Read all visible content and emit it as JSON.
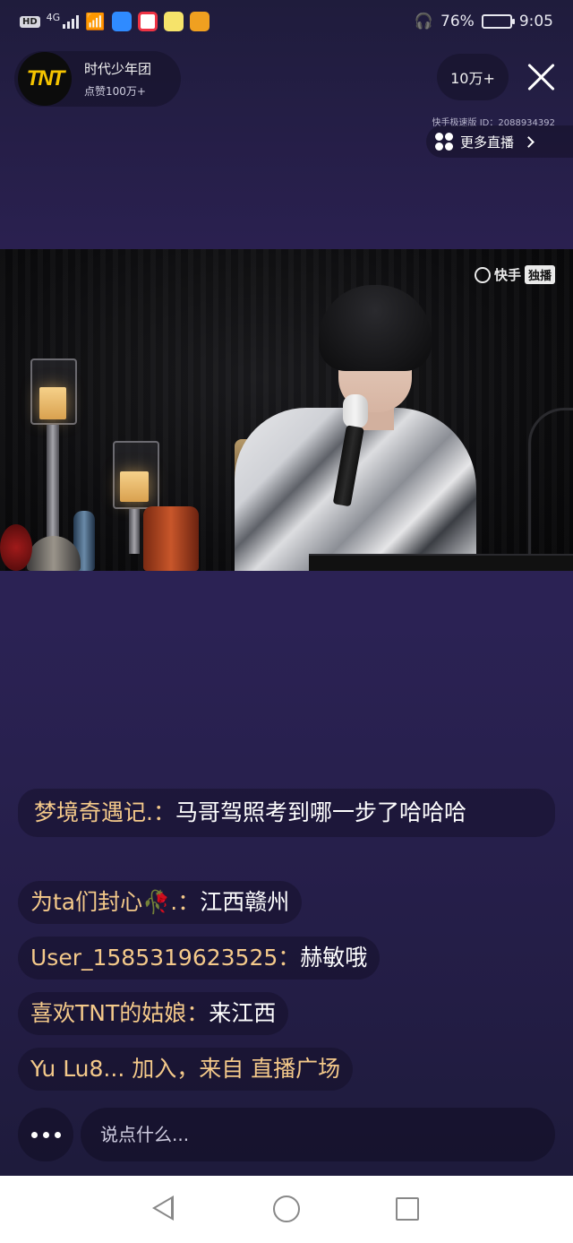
{
  "status_bar": {
    "hd_badge": "HD",
    "network": "4G",
    "battery_percent": "76%",
    "battery_level": 0.76,
    "time": "9:05"
  },
  "host": {
    "avatar_text": "TNT",
    "name": "时代少年团",
    "likes": "点赞100万+"
  },
  "viewers": "10万+",
  "room_id": "快手极速版 ID：2088934392",
  "more_live_label": "更多直播",
  "video": {
    "watermark_brand": "快手",
    "watermark_tag": "独播"
  },
  "chat": [
    {
      "user": "梦境奇遇记.：",
      "message": "马哥驾照考到哪一步了哈哈哈"
    },
    {
      "user": "为ta们封心🥀.：",
      "message": "江西赣州"
    },
    {
      "user": "User_1585319623525：",
      "message": "赫敏哦"
    },
    {
      "user": "喜欢TNT的姑娘：",
      "message": "来江西"
    },
    {
      "user": "Yu Lu8... ",
      "message": "加入，来自 直播广场"
    }
  ],
  "comment_input": {
    "placeholder": "说点什么..."
  },
  "colors": {
    "background": "#2a2050",
    "username": "#f4c98a",
    "accent_yellow": "#f5c400"
  }
}
